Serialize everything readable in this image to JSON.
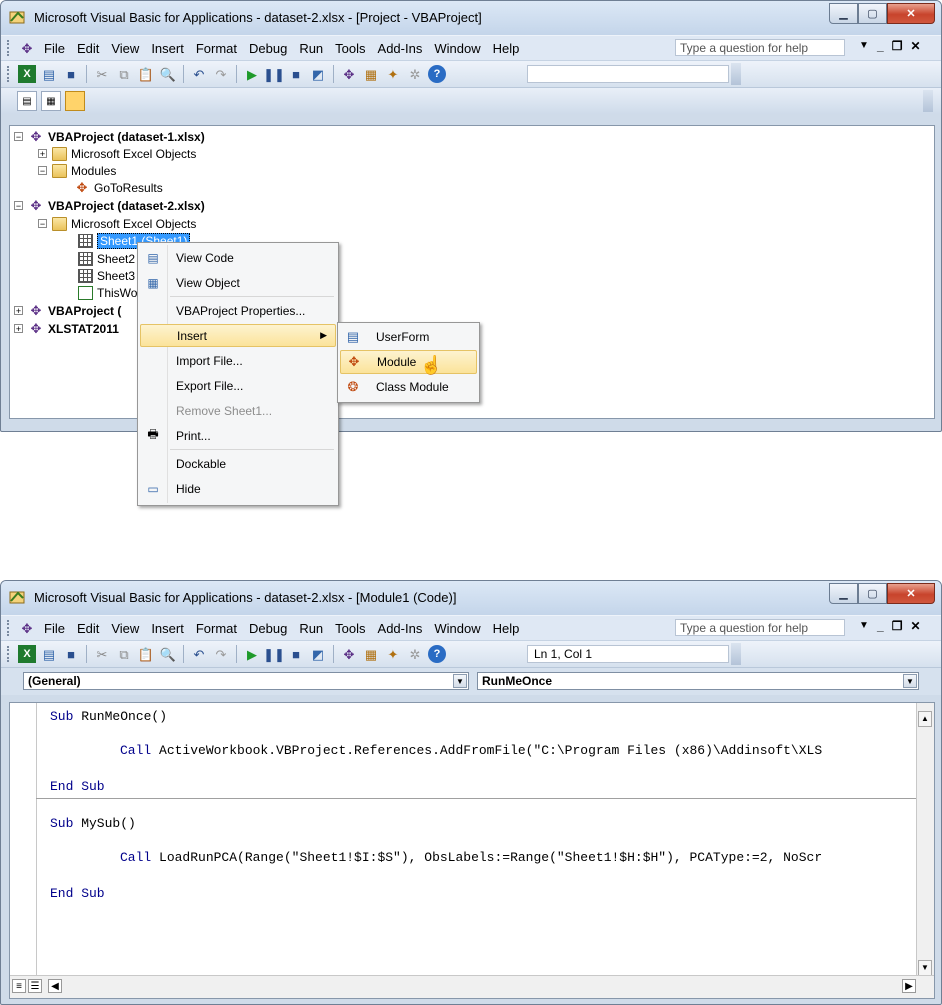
{
  "window1": {
    "title": "Microsoft Visual Basic for Applications - dataset-2.xlsx - [Project - VBAProject]",
    "tree": {
      "project1": "VBAProject (dataset-1.xlsx)",
      "project1_excel_objects": "Microsoft Excel Objects",
      "project1_modules": "Modules",
      "project1_module_item": "GoToResults",
      "project2": "VBAProject (dataset-2.xlsx)",
      "project2_excel_objects": "Microsoft Excel Objects",
      "sheet1": "Sheet1 (Sheet1)",
      "sheet2": "Sheet2",
      "sheet3": "Sheet3",
      "thisworkbook": "ThisWo",
      "project3": "VBAProject (",
      "project4": "XLSTAT2011"
    },
    "context_menu": {
      "view_code": "View Code",
      "view_object": "View Object",
      "properties": "VBAProject Properties...",
      "insert": "Insert",
      "import_file": "Import File...",
      "export_file": "Export File...",
      "remove": "Remove Sheet1...",
      "print": "Print...",
      "dockable": "Dockable",
      "hide": "Hide"
    },
    "submenu": {
      "userform": "UserForm",
      "module": "Module",
      "class_module": "Class Module"
    }
  },
  "window2": {
    "title": "Microsoft Visual Basic for Applications - dataset-2.xlsx - [Module1 (Code)]",
    "position": "Ln 1, Col 1",
    "object_combo": "(General)",
    "proc_combo": "RunMeOnce",
    "code": {
      "l1_kw": "Sub",
      "l1_rest": " RunMeOnce()",
      "l2_kw": "Call",
      "l2_rest": " ActiveWorkbook.VBProject.References.AddFromFile(\"C:\\Program Files (x86)\\Addinsoft\\XLS",
      "l3_kw": "End Sub",
      "l4_kw": "Sub",
      "l4_rest": " MySub()",
      "l5_kw": "Call",
      "l5_rest": " LoadRunPCA(Range(\"Sheet1!$I:$S\"), ObsLabels:=Range(\"Sheet1!$H:$H\"), PCAType:=2, NoScr",
      "l6_kw": "End Sub"
    }
  },
  "menu": {
    "file": "File",
    "edit": "Edit",
    "view": "View",
    "insert": "Insert",
    "format": "Format",
    "debug": "Debug",
    "run": "Run",
    "tools": "Tools",
    "addins": "Add-Ins",
    "window": "Window",
    "help": "Help"
  },
  "help_placeholder": "Type a question for help"
}
